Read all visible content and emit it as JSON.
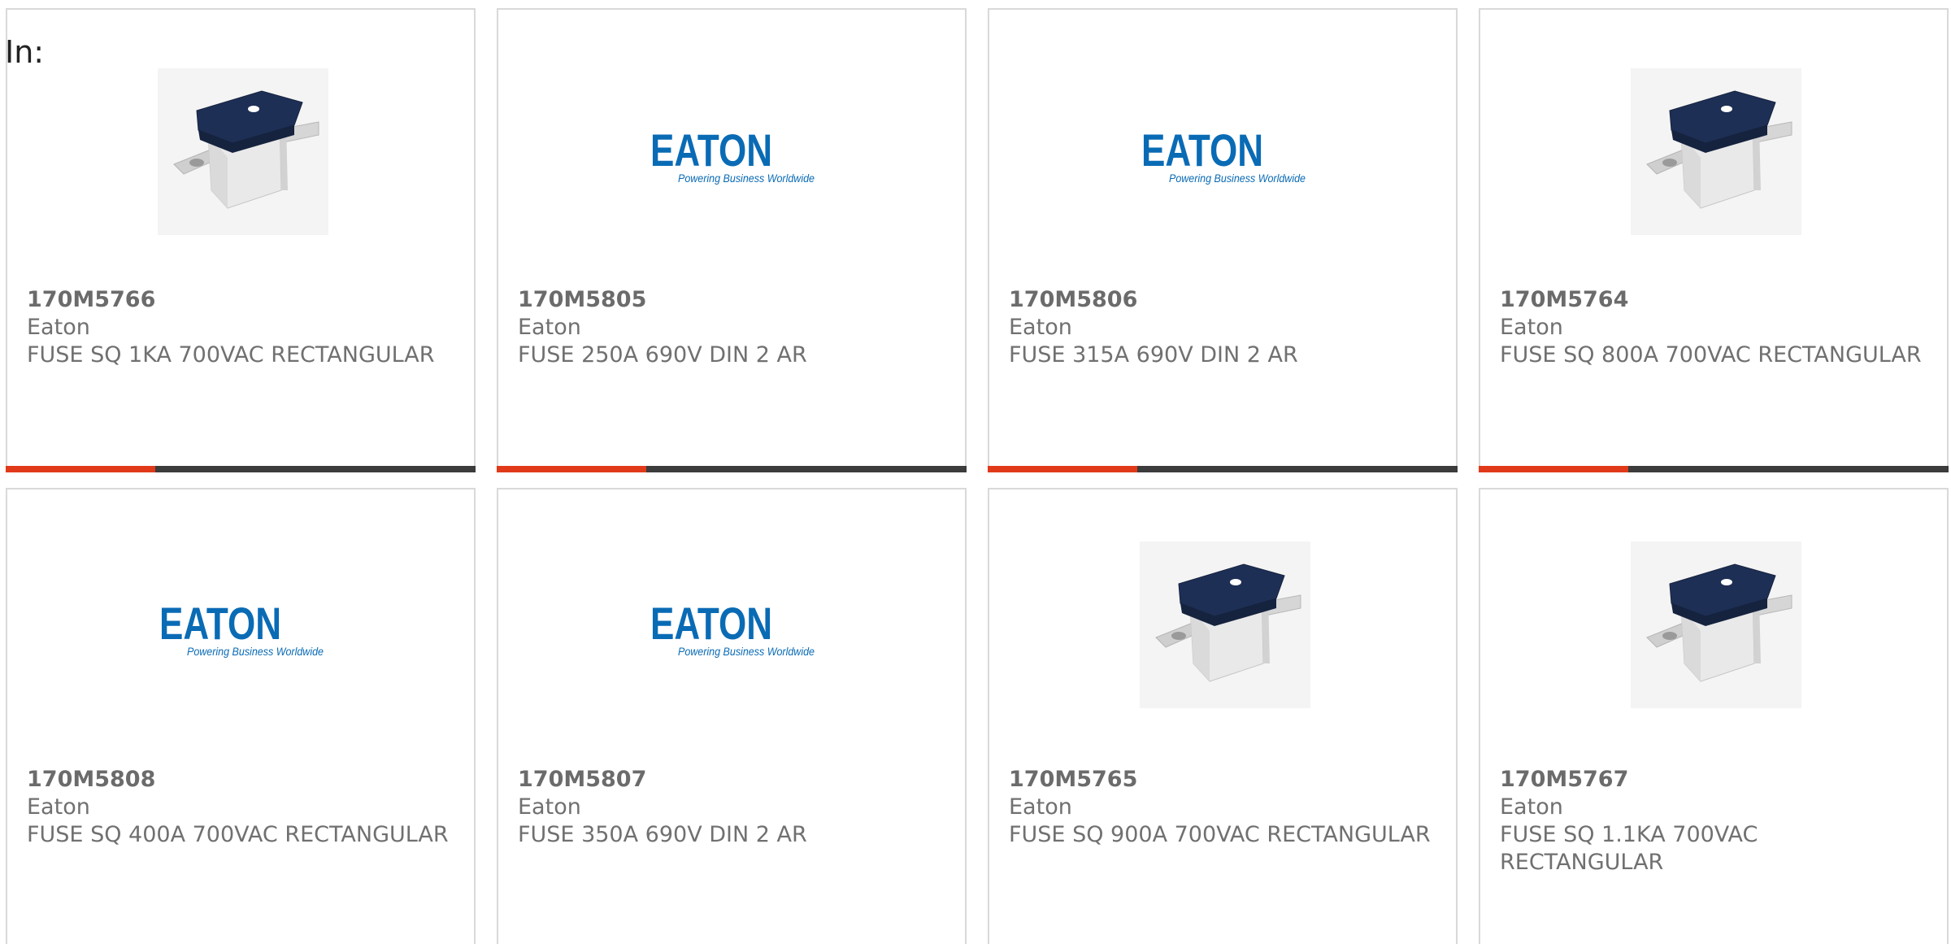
{
  "breadcrumb": {
    "label": "In:"
  },
  "colors": {
    "accent": "#e03a1a",
    "bar": "#3c3c3c",
    "eaton_blue": "#0a6bb5",
    "border": "#d9d9d9"
  },
  "products": [
    {
      "part_number": "170M5766",
      "manufacturer": "Eaton",
      "description": "FUSE SQ 1KA 700VAC RECTANGULAR",
      "image": "square-fuse-photo"
    },
    {
      "part_number": "170M5805",
      "manufacturer": "Eaton",
      "description": "FUSE 250A 690V DIN 2 AR",
      "image": "eaton-logo",
      "logo_text": "EATON",
      "logo_tagline": "Powering Business Worldwide"
    },
    {
      "part_number": "170M5806",
      "manufacturer": "Eaton",
      "description": "FUSE 315A 690V DIN 2 AR",
      "image": "eaton-logo",
      "logo_text": "EATON",
      "logo_tagline": "Powering Business Worldwide"
    },
    {
      "part_number": "170M5764",
      "manufacturer": "Eaton",
      "description": "FUSE SQ 800A 700VAC RECTANGULAR",
      "image": "square-fuse-photo"
    },
    {
      "part_number": "170M5808",
      "manufacturer": "Eaton",
      "description": "FUSE SQ 400A 700VAC RECTANGULAR",
      "image": "eaton-logo",
      "logo_text": "EATON",
      "logo_tagline": "Powering Business Worldwide"
    },
    {
      "part_number": "170M5807",
      "manufacturer": "Eaton",
      "description": "FUSE 350A 690V DIN 2 AR",
      "image": "eaton-logo",
      "logo_text": "EATON",
      "logo_tagline": "Powering Business Worldwide"
    },
    {
      "part_number": "170M5765",
      "manufacturer": "Eaton",
      "description": "FUSE SQ 900A 700VAC RECTANGULAR",
      "image": "square-fuse-photo"
    },
    {
      "part_number": "170M5767",
      "manufacturer": "Eaton",
      "description": "FUSE SQ 1.1KA 700VAC RECTANGULAR",
      "image": "square-fuse-photo"
    }
  ]
}
